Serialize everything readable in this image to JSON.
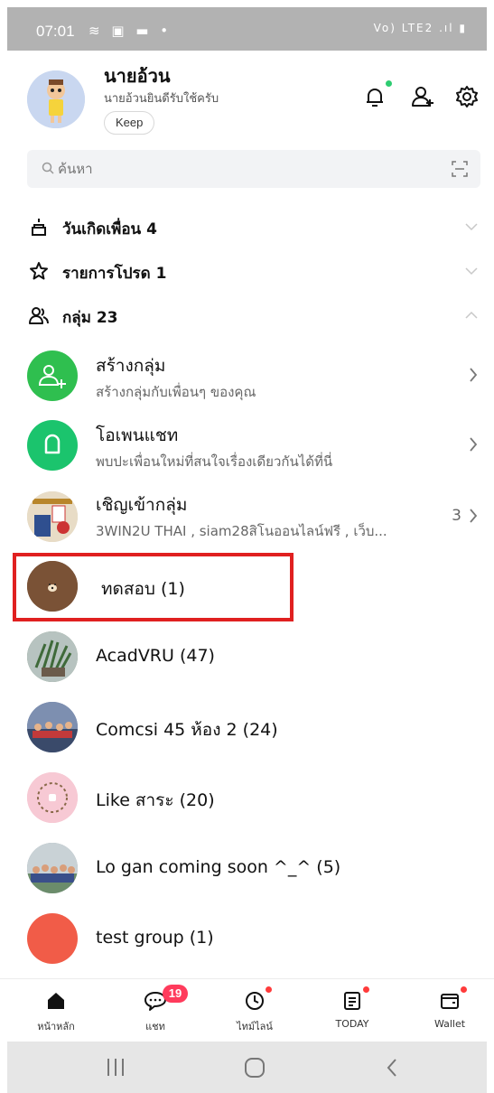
{
  "status_bar": {
    "time": "07:01",
    "left_icons": "≋ ▣ ▬ •",
    "right_icons": "Vo) LTE2 .ıl ▮"
  },
  "profile": {
    "name": "นายอ้วน",
    "status_message": "นายอ้วนยินดีรับใช้ครับ",
    "keep_label": "Keep"
  },
  "search": {
    "placeholder": "ค้นหา"
  },
  "sections": [
    {
      "label": "วันเกิดเพื่อน 4",
      "icon": "cake-icon",
      "expanded": false
    },
    {
      "label": "รายการโปรด 1",
      "icon": "star-icon",
      "expanded": false
    },
    {
      "label": "กลุ่ม 23",
      "icon": "group-icon",
      "expanded": true
    }
  ],
  "actions": [
    {
      "title": "สร้างกลุ่ม",
      "subtitle": "สร้างกลุ่มกับเพื่อนๆ ของคุณ",
      "color": "#2fbf4f"
    },
    {
      "title": "โอเพนแชท",
      "subtitle": "พบปะเพื่อนใหม่ที่สนใจเรื่องเดียวกันได้ที่นี่",
      "color": "#1bc46d"
    },
    {
      "title": "เชิญเข้ากลุ่ม",
      "subtitle": "3WIN2U THAI , siam28สิโนออนไลน์ฟรี , เว็บ...",
      "count": "3"
    }
  ],
  "groups": [
    {
      "name": "ทดสอบ (1)",
      "color": "#7a5236",
      "highlighted": true
    },
    {
      "name": "AcadVRU (47)",
      "color": "#6f8a6a"
    },
    {
      "name": "Comcsi 45 ห้อง 2 (24)",
      "color": "#5a6f9a"
    },
    {
      "name": "Like สาระ (20)",
      "color": "#f2b8c6"
    },
    {
      "name": "Lo gan coming soon ^_^ (5)",
      "color": "#8fa0a8"
    },
    {
      "name": "test group (1)",
      "color": "#f15c48"
    }
  ],
  "tabs": [
    {
      "label": "หน้าหลัก",
      "icon": "home-icon",
      "active": true
    },
    {
      "label": "แชท",
      "icon": "chat-icon",
      "badge": "19"
    },
    {
      "label": "ไทม์ไลน์",
      "icon": "timeline-icon",
      "dot": true
    },
    {
      "label": "TODAY",
      "icon": "today-icon",
      "dot": true
    },
    {
      "label": "Wallet",
      "icon": "wallet-icon",
      "dot": true
    }
  ],
  "colors": {
    "highlight_border": "#e02020",
    "online_dot": "#2ecc71",
    "notification_dot": "#ff3b3b",
    "badge": "#ff3b5c"
  }
}
